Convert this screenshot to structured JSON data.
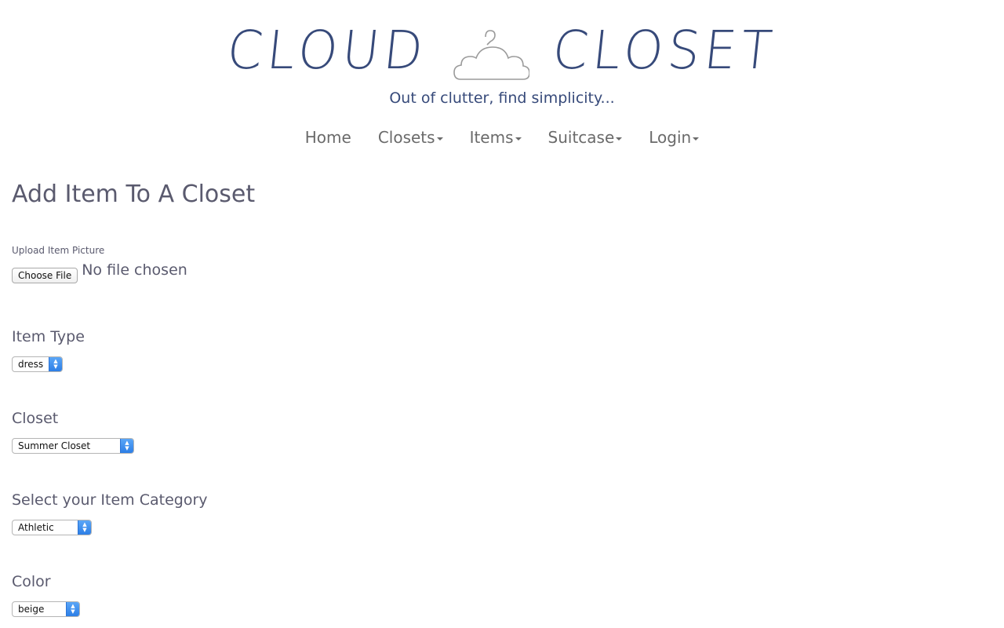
{
  "brand": {
    "word_left": "CLOUD",
    "word_right": "CLOSET",
    "tagline": "Out of clutter, find simplicity..."
  },
  "nav": {
    "home": "Home",
    "closets": "Closets",
    "items": "Items",
    "suitcase": "Suitcase",
    "login": "Login"
  },
  "form": {
    "title": "Add Item To A Closet",
    "upload_label": "Upload Item Picture",
    "choose_file": "Choose File",
    "file_status": "No file chosen",
    "item_type_label": "Item Type",
    "item_type_value": "dress",
    "closet_label": "Closet",
    "closet_value": "Summer Closet",
    "category_label": "Select your Item Category",
    "category_value": "Athletic",
    "color_label": "Color",
    "color_value": "beige"
  },
  "colors": {
    "brand_navy": "#374a7a",
    "select_accent": "#2c7ee6"
  }
}
